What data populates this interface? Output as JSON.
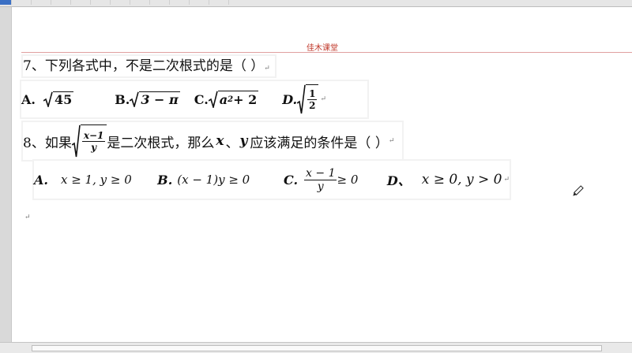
{
  "document": {
    "header": "佳木课堂",
    "q7": {
      "stem": "7、下列各式中，不是二次根式的是（      ）",
      "options": [
        {
          "label": "A.",
          "radicand": "45"
        },
        {
          "label": "B.",
          "radicand": "3 − π"
        },
        {
          "label": "C.",
          "radicand_base": "a",
          "radicand_exp": "2",
          "radicand_tail": " + 2"
        },
        {
          "label": "D.",
          "frac_num": "1",
          "frac_den": "2"
        }
      ]
    },
    "q8": {
      "stem_prefix": "8、如果",
      "radical_num": "x−1",
      "radical_den": "y",
      "stem_mid": "是二次根式，那么",
      "var_x": "x",
      "sep": "、",
      "var_y": "y",
      "stem_end": "应该满足的条件是（     ）",
      "options": [
        {
          "label": "A.",
          "expr": "x ≥ 1, y ≥ 0"
        },
        {
          "label": "B.",
          "expr": "(x − 1)y ≥ 0"
        },
        {
          "label": "C.",
          "frac_num": "x − 1",
          "frac_den": "y",
          "tail": " ≥ 0"
        },
        {
          "label": "D、",
          "expr": "x ≥ 0, y > 0"
        }
      ]
    },
    "para_mark": "↵"
  },
  "colors": {
    "header": "#c0392b",
    "ribbon_active": "#3a6fc4"
  }
}
